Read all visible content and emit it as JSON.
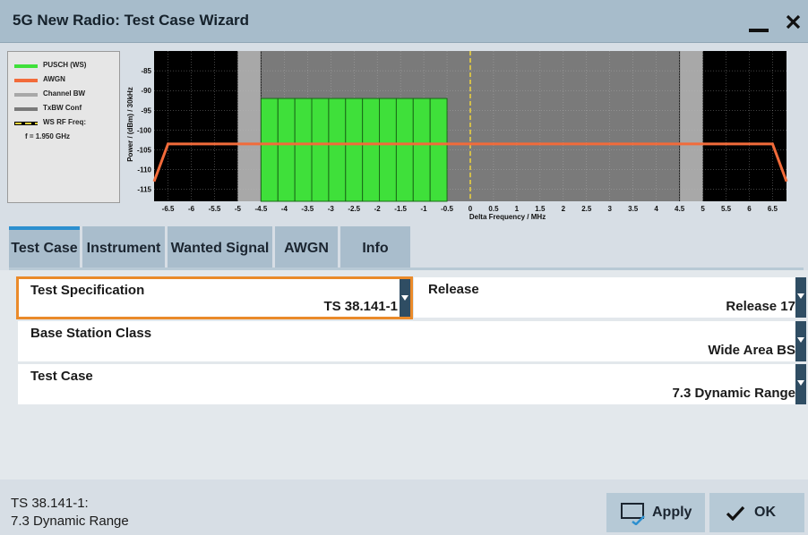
{
  "window": {
    "title": "5G New Radio: Test Case Wizard",
    "minimize_icon": "minimize-icon",
    "close_icon": "close-icon"
  },
  "legend": {
    "items": [
      {
        "label": "PUSCH (WS)",
        "color": "#3fe03a"
      },
      {
        "label": "AWGN",
        "color": "#f26b3a"
      },
      {
        "label": "Channel BW",
        "color": "#a8a8a8"
      },
      {
        "label": "TxBW Conf",
        "color": "#7a7a7a"
      },
      {
        "label": "WS RF Freq:",
        "color": "#f0d43a",
        "dashed": true
      },
      {
        "label": "f = 1.950 GHz"
      }
    ]
  },
  "chart_data": {
    "type": "spectrum",
    "xlabel": "Delta Frequency / MHz",
    "ylabel": "Power / (dBm) / 30kHz",
    "xlim": [
      -6.8,
      6.8
    ],
    "ylim": [
      -118,
      -80
    ],
    "x_ticks": [
      "-6.5",
      "-6",
      "-5.5",
      "-5",
      "-4.5",
      "-4",
      "-3.5",
      "-3",
      "-2.5",
      "-2",
      "-1.5",
      "-1",
      "-0.5",
      "0",
      "0.5",
      "1",
      "1.5",
      "2",
      "2.5",
      "3",
      "3.5",
      "4",
      "4.5",
      "5",
      "5.5",
      "6",
      "6.5"
    ],
    "x_tick_values": [
      -6.5,
      -6,
      -5.5,
      -5,
      -4.5,
      -4,
      -3.5,
      -3,
      -2.5,
      -2,
      -1.5,
      -1,
      -0.5,
      0,
      0.5,
      1,
      1.5,
      2,
      2.5,
      3,
      3.5,
      4,
      4.5,
      5,
      5.5,
      6,
      6.5
    ],
    "y_ticks": [
      "-85",
      "-90",
      "-95",
      "-100",
      "-105",
      "-110",
      "-115"
    ],
    "y_tick_values": [
      -85,
      -90,
      -95,
      -100,
      -105,
      -110,
      -115
    ],
    "channel_bw": [
      -5,
      5
    ],
    "txbw_conf": [
      -4.5,
      4.5
    ],
    "ws_rf_freq": 0,
    "pusch": {
      "x_start": -4.5,
      "x_end": -0.5,
      "level": -92,
      "blocks": 11
    },
    "awgn": {
      "x": [
        -6.8,
        -6.5,
        6.5,
        6.8
      ],
      "y": [
        -113,
        -103.5,
        -103.5,
        -113
      ]
    },
    "colors": {
      "background": "#000000",
      "channel_bw": "#a8a8a8",
      "txbw_conf": "#7a7a7a",
      "pusch": "#3fe03a",
      "awgn": "#f26b3a",
      "ws_rf": "#f0d43a"
    }
  },
  "tabs": [
    {
      "label": "Test Case",
      "active": true
    },
    {
      "label": "Instrument"
    },
    {
      "label": "Wanted Signal"
    },
    {
      "label": "AWGN"
    },
    {
      "label": "Info"
    }
  ],
  "fields": {
    "test_spec": {
      "label": "Test Specification",
      "value": "TS 38.141-1"
    },
    "release": {
      "label": "Release",
      "value": "Release 17"
    },
    "bs_class": {
      "label": "Base Station Class",
      "value": "Wide Area BS"
    },
    "test_case": {
      "label": "Test Case",
      "value": "7.3  Dynamic Range"
    }
  },
  "status": {
    "line1": "TS 38.141-1:",
    "line2": "7.3 Dynamic Range"
  },
  "buttons": {
    "apply": {
      "label": "Apply",
      "icon": "apply-icon"
    },
    "ok": {
      "label": "OK",
      "icon": "check-icon"
    }
  }
}
